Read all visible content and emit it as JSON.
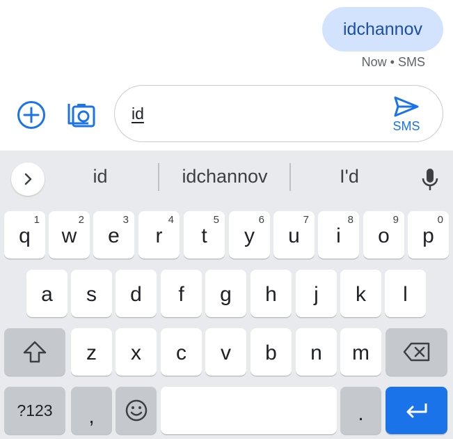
{
  "conversation": {
    "message_text": "idchannov",
    "message_meta": "Now • SMS"
  },
  "compose": {
    "input_value": "id",
    "send_label": "SMS",
    "icons": {
      "add": "add-circle-icon",
      "gallery": "camera-gallery-icon",
      "send": "send-icon"
    }
  },
  "keyboard": {
    "suggestions": [
      "id",
      "idchannov",
      "I'd"
    ],
    "row1": [
      {
        "key": "q",
        "hint": "1"
      },
      {
        "key": "w",
        "hint": "2"
      },
      {
        "key": "e",
        "hint": "3"
      },
      {
        "key": "r",
        "hint": "4"
      },
      {
        "key": "t",
        "hint": "5"
      },
      {
        "key": "y",
        "hint": "6"
      },
      {
        "key": "u",
        "hint": "7"
      },
      {
        "key": "i",
        "hint": "8"
      },
      {
        "key": "o",
        "hint": "9"
      },
      {
        "key": "p",
        "hint": "0"
      }
    ],
    "row2": [
      "a",
      "s",
      "d",
      "f",
      "g",
      "h",
      "j",
      "k",
      "l"
    ],
    "row3": [
      "z",
      "x",
      "c",
      "v",
      "b",
      "n",
      "m"
    ],
    "symbols_label": "?123",
    "comma_label": ",",
    "period_label": ".",
    "colors": {
      "accent": "#1a73e8",
      "bubble": "#d3e3fd",
      "keyboard_bg": "#e8eaed"
    }
  }
}
